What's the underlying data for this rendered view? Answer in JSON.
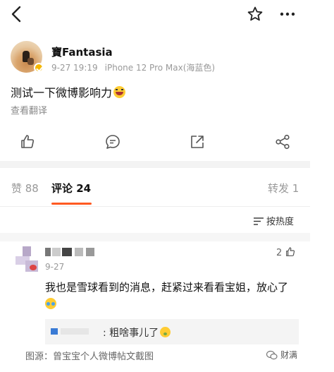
{
  "post": {
    "username": "寶Fantasia",
    "time": "9-27 19:19",
    "device": "iPhone 12 Pro Max(海蓝色)",
    "text": "测试一下微博影响力",
    "translate_label": "查看翻译"
  },
  "tabs": {
    "likes": "赞 88",
    "comments": "评论 24",
    "reposts": "转发 1"
  },
  "sort_label": "按热度",
  "comment": {
    "time": "9-27",
    "likes": "2",
    "text": "我也是雪球看到的消息，赶紧过来看看宝姐，放心了",
    "reply_text": ": 粗啥事儿了"
  },
  "caption": "图源：曾宝宝个人微博帖文截图",
  "watermark": "财满",
  "colors": {
    "accent": "#ff5a22",
    "badge": "#f5b800",
    "link": "#3a7bd5"
  },
  "icons": [
    "back-icon",
    "star-icon",
    "more-icon",
    "like-icon",
    "comment-icon",
    "share-icon",
    "forward-icon",
    "sort-icon",
    "wechat-icon"
  ]
}
